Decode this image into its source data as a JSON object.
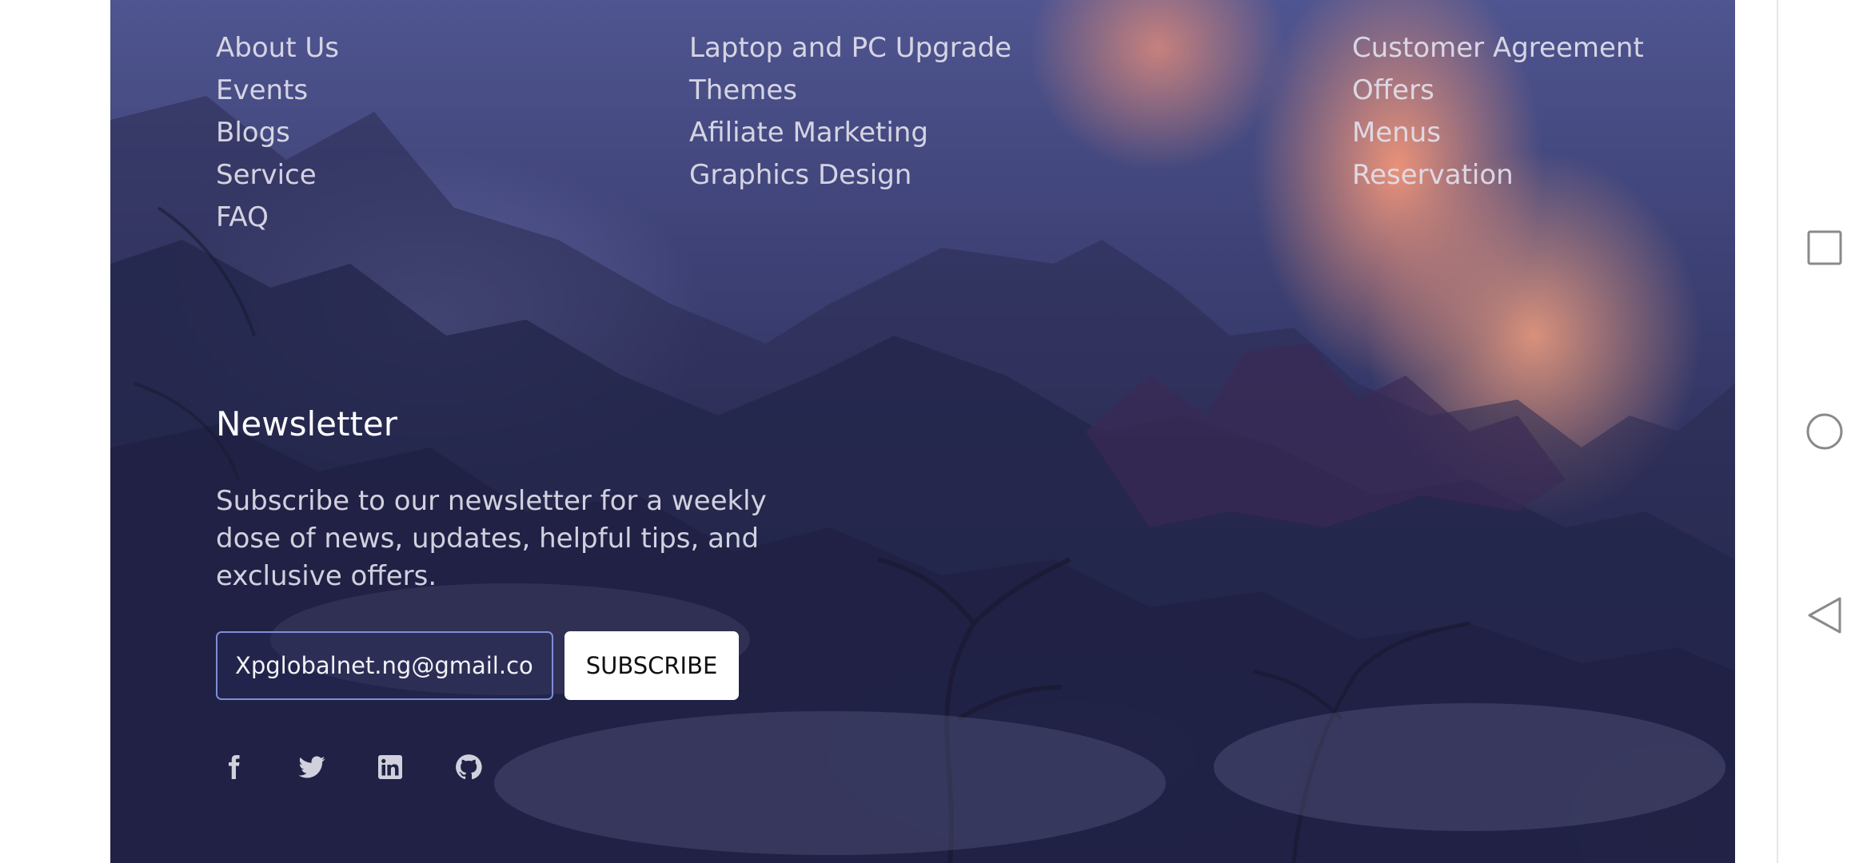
{
  "footer": {
    "columns": [
      [
        "About Us",
        "Events",
        "Blogs",
        "Service",
        "FAQ"
      ],
      [
        "Laptop and PC Upgrade",
        "Themes",
        "Afiliate Marketing",
        "Graphics Design"
      ],
      [
        "Customer Agreement",
        "Offers",
        "Menus",
        "Reservation"
      ]
    ],
    "newsletter": {
      "title": "Newsletter",
      "description": "Subscribe to our newsletter for a weekly dose of news, updates, helpful tips, and exclusive offers.",
      "email_value": "Xpglobalnet.ng@gmail.com",
      "subscribe_label": "SUBSCRIBE"
    },
    "social_icons": [
      "facebook-icon",
      "twitter-icon",
      "linkedin-icon",
      "github-icon"
    ]
  },
  "colors": {
    "input_border": "#7d8fd6",
    "button_bg": "#ffffff",
    "link_text": "#e2e0ec"
  },
  "navigation_bar": {
    "buttons": [
      "recents-icon",
      "home-icon",
      "back-icon"
    ]
  }
}
